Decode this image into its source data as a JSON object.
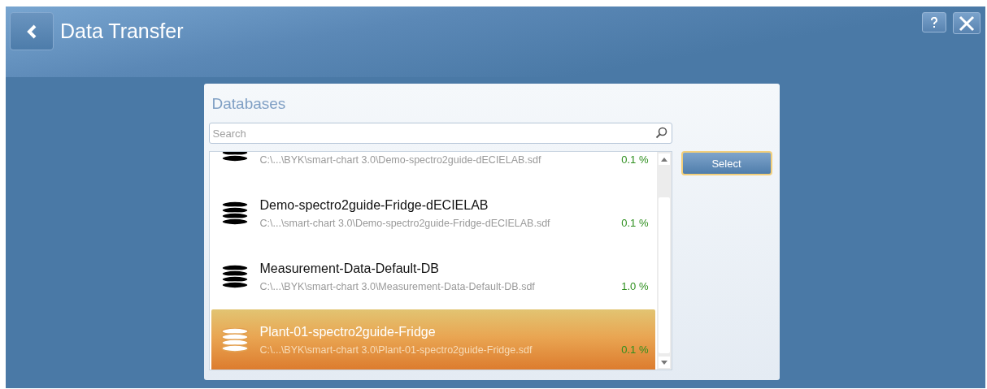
{
  "header": {
    "title": "Data Transfer"
  },
  "panel": {
    "title": "Databases",
    "search": {
      "placeholder": "Search"
    },
    "rows": [
      {
        "path": "C:\\...\\BYK\\smart-chart 3.0\\Demo-spectro2guide-dECIELAB.sdf",
        "usage": "0.1 %",
        "selected": false
      },
      {
        "name": "Demo-spectro2guide-Fridge-dECIELAB",
        "path": "C:\\...\\smart-chart 3.0\\Demo-spectro2guide-Fridge-dECIELAB.sdf",
        "usage": "0.1 %",
        "selected": false
      },
      {
        "name": "Measurement-Data-Default-DB",
        "path": "C:\\...\\BYK\\smart-chart 3.0\\Measurement-Data-Default-DB.sdf",
        "usage": "1.0 %",
        "selected": false
      },
      {
        "name": "Plant-01-spectro2guide-Fridge",
        "path": "C:\\...\\BYK\\smart-chart 3.0\\Plant-01-spectro2guide-Fridge.sdf",
        "usage": "0.1 %",
        "selected": true
      }
    ],
    "select_button": "Select"
  }
}
